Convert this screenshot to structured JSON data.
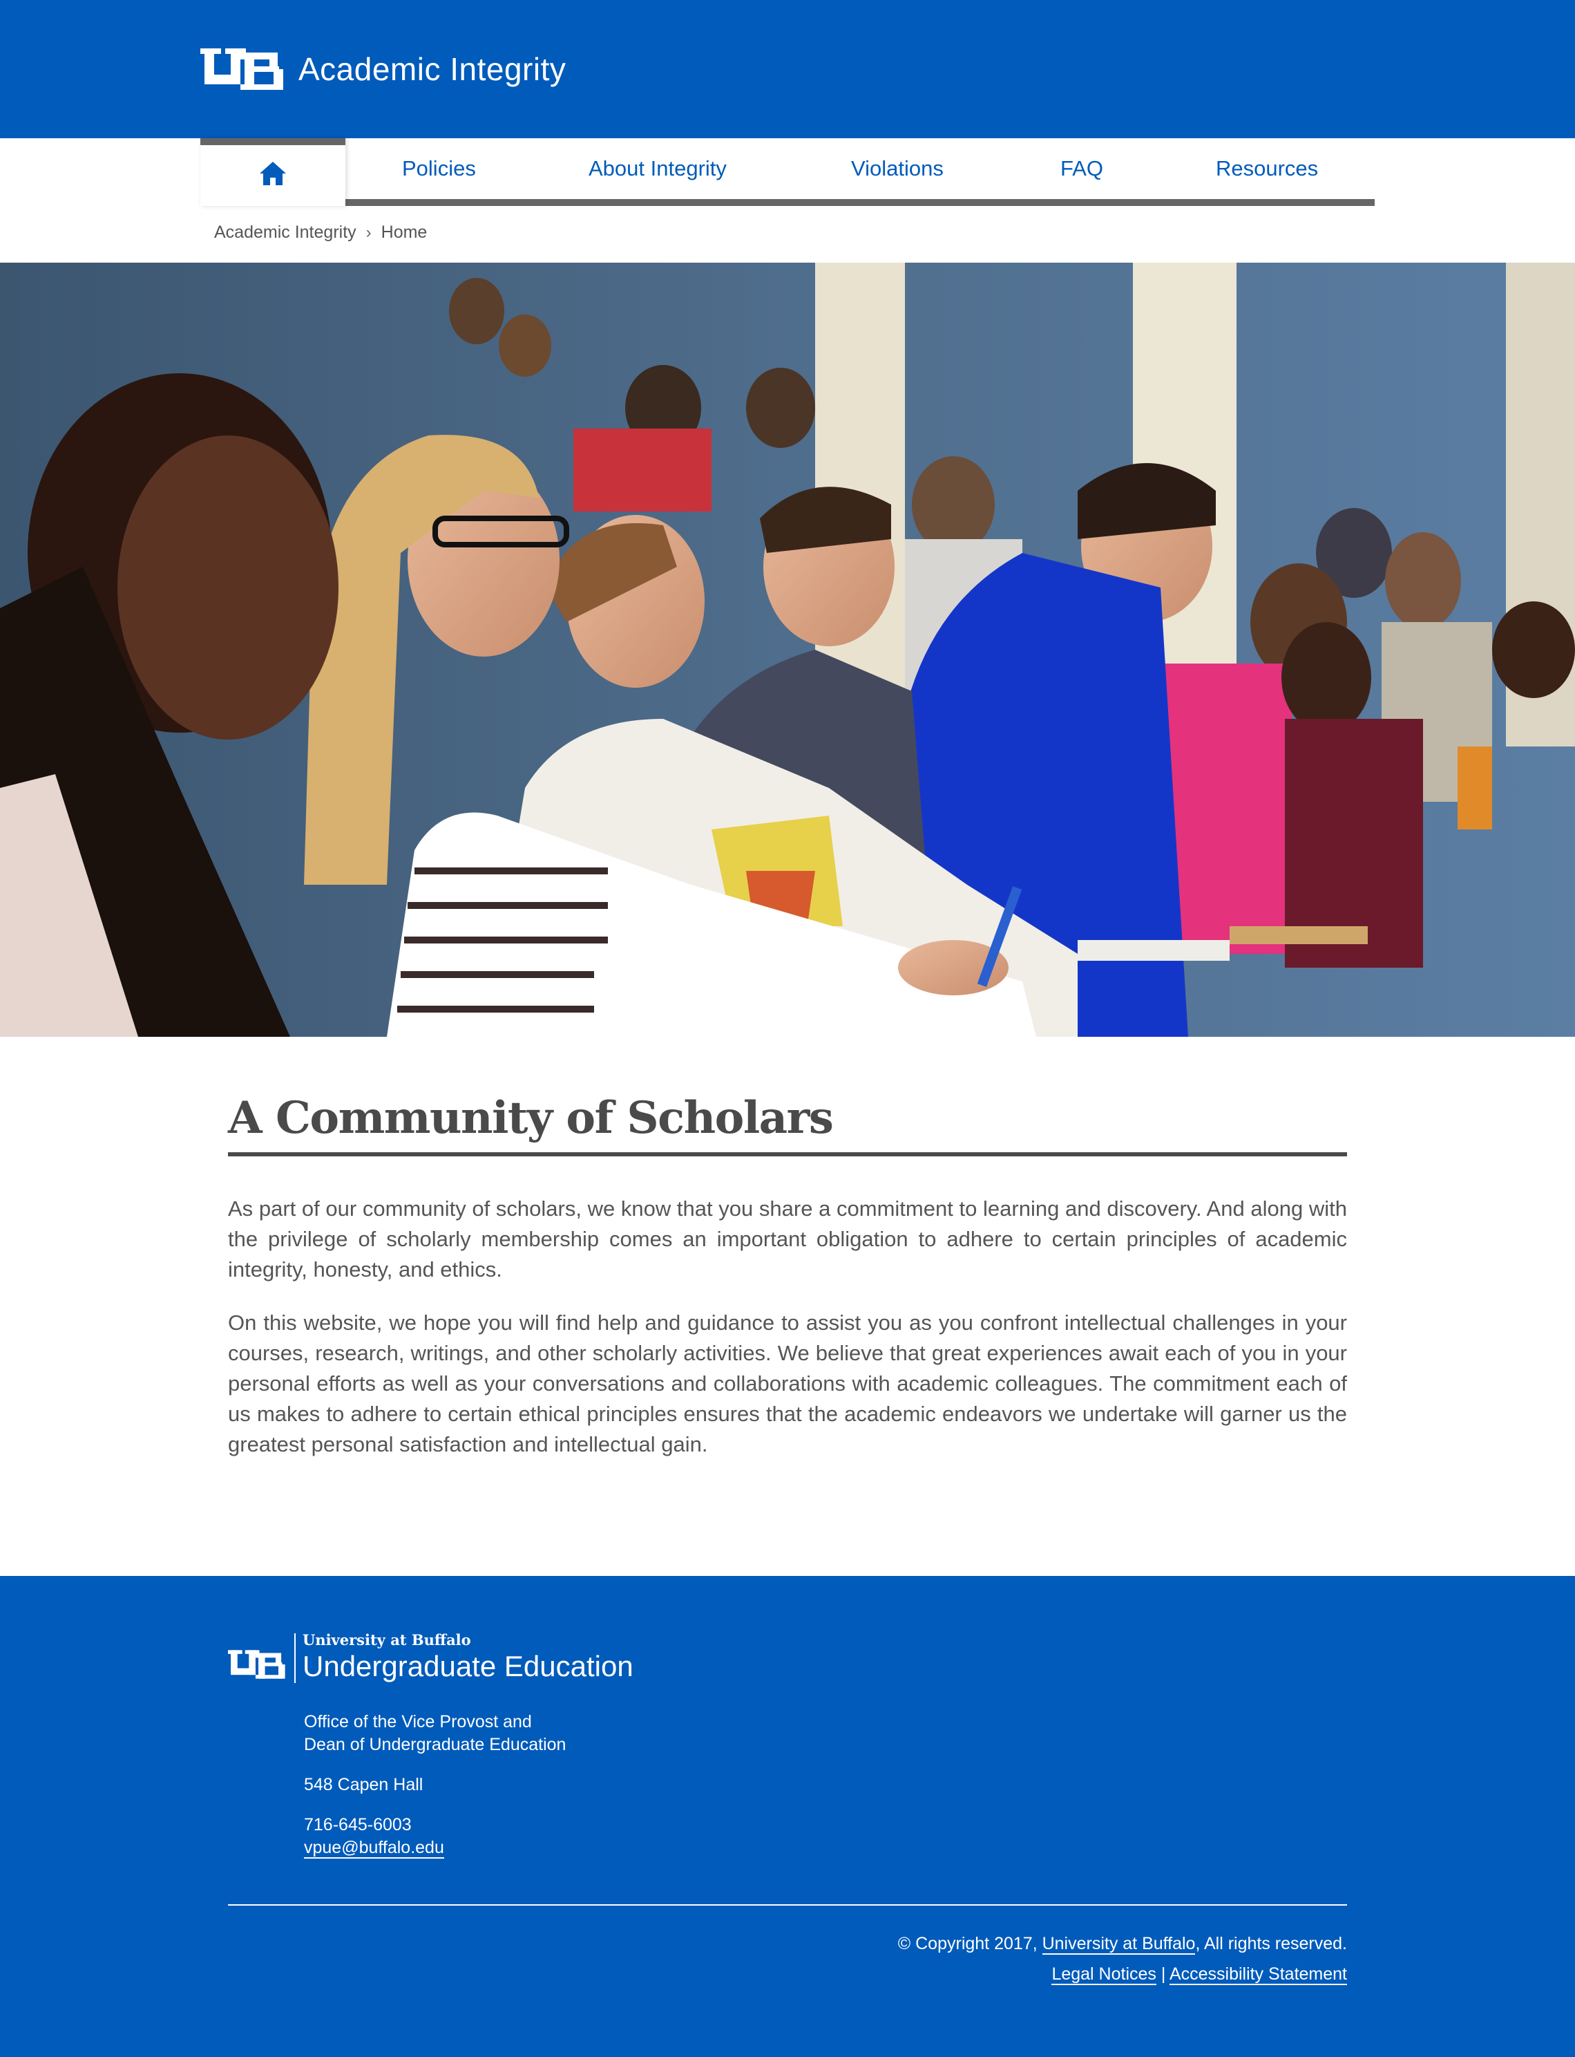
{
  "header": {
    "logo_icon": "ub-logo-icon",
    "site_title": "Academic Integrity",
    "background_color": "#005bbb"
  },
  "nav": {
    "home_icon": "home-icon",
    "items": [
      {
        "label": "Policies"
      },
      {
        "label": "About Integrity"
      },
      {
        "label": "Violations"
      },
      {
        "label": "FAQ"
      },
      {
        "label": "Resources"
      }
    ]
  },
  "breadcrumb": {
    "items": [
      "Academic Integrity",
      "Home"
    ],
    "separator_icon": "chevron-right-icon"
  },
  "hero": {
    "icon": "lecture-hall-photo"
  },
  "main": {
    "title": "A Community of Scholars",
    "paragraphs": [
      "As part of our community of scholars, we know that you share a commitment to learning and discovery. And along with the privilege of scholarly membership comes an important obligation to adhere to certain principles of academic integrity, honesty, and ethics.",
      "On this website, we hope you will find help and guidance to assist you as you confront intellectual challenges in your courses, research, writings, and other scholarly activities. We believe that great experiences await each of you in your personal efforts as well as your conversations and collaborations with academic colleagues. The commitment each of us makes to adhere to certain ethical principles ensures that the academic endeavors we undertake will garner us the greatest personal satisfaction and intellectual gain."
    ]
  },
  "footer": {
    "university": "University at Buffalo",
    "unit": "Undergraduate Education",
    "office_line1": "Office of the Vice Provost and",
    "office_line2": "Dean of Undergraduate Education",
    "address": "548 Capen Hall",
    "phone": "716-645-6003",
    "email": "vpue@buffalo.edu",
    "copyright_prefix": "© Copyright 2017, ",
    "copyright_link": "University at Buffalo",
    "copyright_suffix": ", All rights reserved.",
    "legal_notices": "Legal Notices",
    "link_separator": "|",
    "accessibility": "Accessibility Statement"
  },
  "colors": {
    "brand_blue": "#005bbb",
    "nav_gray": "#666666",
    "text_gray": "#555555"
  }
}
